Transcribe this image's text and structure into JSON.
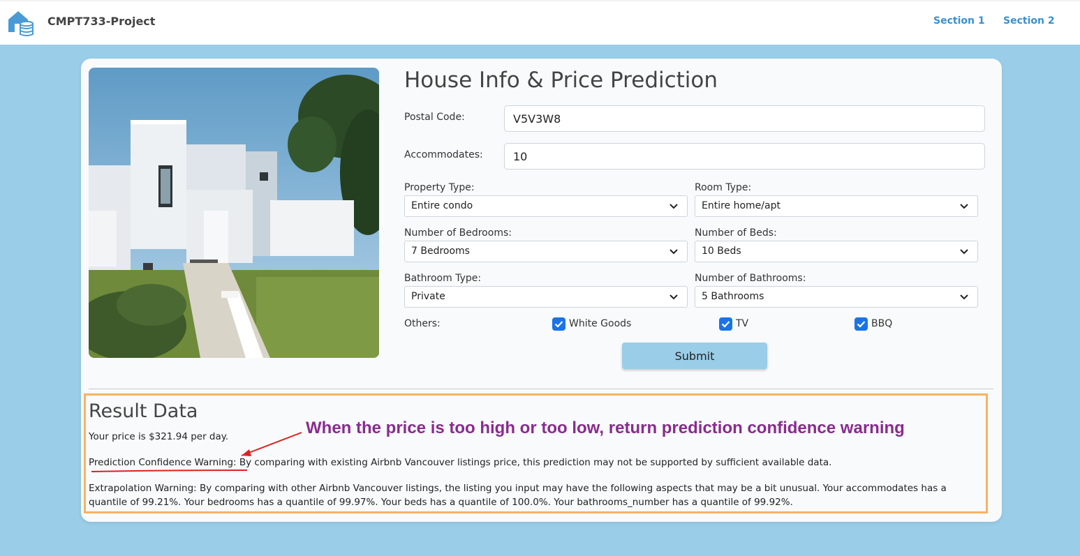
{
  "app": {
    "brand": "CMPT733-Project",
    "nav": [
      "Section 1",
      "Section 2"
    ]
  },
  "form": {
    "title": "House Info & Price Prediction",
    "postal_code": {
      "label": "Postal Code:",
      "value": "V5V3W8"
    },
    "accommodates": {
      "label": "Accommodates:",
      "value": "10"
    },
    "property_type": {
      "label": "Property Type:",
      "value": "Entire condo"
    },
    "room_type": {
      "label": "Room Type:",
      "value": "Entire home/apt"
    },
    "bedrooms": {
      "label": "Number of Bedrooms:",
      "value": "7 Bedrooms"
    },
    "beds": {
      "label": "Number of Beds:",
      "value": "10 Beds"
    },
    "bathroom_type": {
      "label": "Bathroom Type:",
      "value": "Private"
    },
    "bathrooms": {
      "label": "Number of Bathrooms:",
      "value": "5 Bathrooms"
    },
    "others": {
      "label": "Others:",
      "options": [
        {
          "label": "White Goods",
          "checked": true
        },
        {
          "label": "TV",
          "checked": true
        },
        {
          "label": "BBQ",
          "checked": true
        }
      ]
    },
    "submit_label": "Submit"
  },
  "result": {
    "title": "Result Data",
    "price": "Your price is $321.94 per day.",
    "confidence_warning": "Prediction Confidence Warning: By comparing with existing Airbnb Vancouver listings price, this prediction may not be supported by sufficient available data.",
    "extrapolation_warning": "Extrapolation Warning: By comparing with other Airbnb Vancouver listings, the listing you input may have the following aspects that may be a bit unusual. Your accommodates has a quantile of 99.21%. Your bedrooms has a quantile of 99.97%. Your beds has a quantile of 100.0%. Your bathrooms_number has a quantile of 99.92%."
  },
  "annotation": "When the price is too high or too low, return prediction confidence warning",
  "colors": {
    "background": "#9acde8",
    "nav_link": "#3a8fcf",
    "checkbox": "#1a73e8",
    "annotation": "#8a2b8e",
    "highlight_border": "#f8b264",
    "arrow": "#e02020"
  },
  "icons": [
    "house-coins-logo-icon",
    "chevron-down-icon",
    "checkmark-icon"
  ]
}
